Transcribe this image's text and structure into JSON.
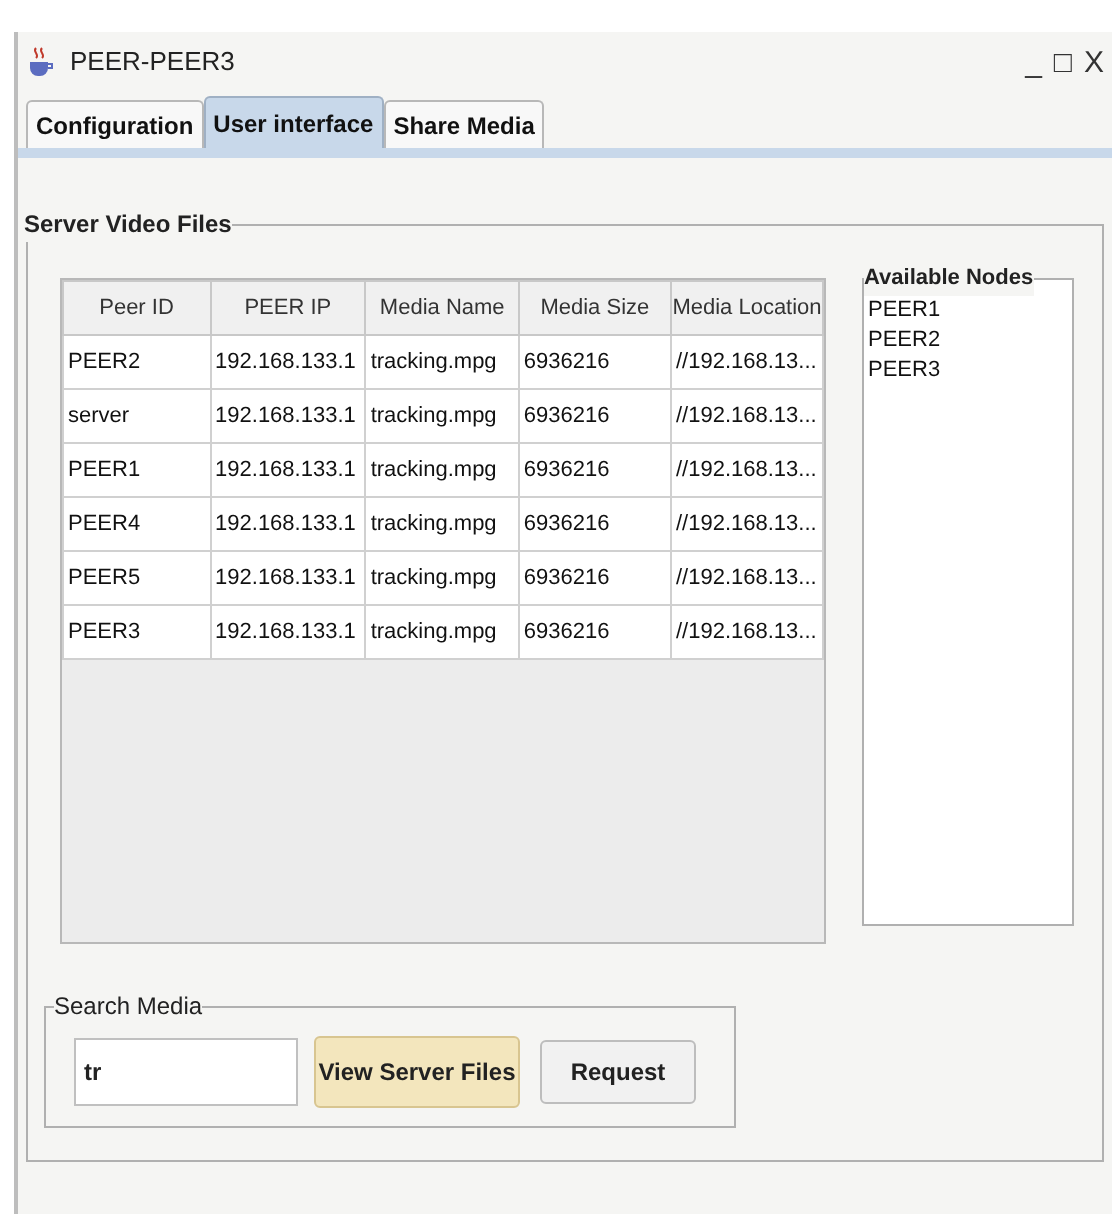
{
  "window": {
    "title": "PEER-PEER3",
    "controls": [
      "_",
      "□",
      "X"
    ]
  },
  "tabs": [
    {
      "label": "Configuration",
      "selected": false
    },
    {
      "label": "User interface",
      "selected": true
    },
    {
      "label": "Share Media",
      "selected": false
    }
  ],
  "server_video_files": {
    "title": "Server Video Files",
    "table": {
      "columns": [
        "Peer ID",
        "PEER IP",
        "Media Name",
        "Media Size",
        "Media Location"
      ],
      "rows": [
        [
          "PEER2",
          "192.168.133.1",
          "tracking.mpg",
          "6936216",
          "//192.168.13..."
        ],
        [
          "server",
          "192.168.133.1",
          "tracking.mpg",
          "6936216",
          "//192.168.13..."
        ],
        [
          "PEER1",
          "192.168.133.1",
          "tracking.mpg",
          "6936216",
          "//192.168.13..."
        ],
        [
          "PEER4",
          "192.168.133.1",
          "tracking.mpg",
          "6936216",
          "//192.168.13..."
        ],
        [
          "PEER5",
          "192.168.133.1",
          "tracking.mpg",
          "6936216",
          "//192.168.13..."
        ],
        [
          "PEER3",
          "192.168.133.1",
          "tracking.mpg",
          "6936216",
          "//192.168.13..."
        ]
      ]
    },
    "available_nodes": {
      "title": "Available Nodes",
      "items": [
        "PEER1",
        "PEER2",
        "PEER3"
      ]
    }
  },
  "search_media": {
    "title": "Search Media",
    "value": "tr",
    "buttons": [
      {
        "label": "View Server Files",
        "kind": "primary"
      },
      {
        "label": "Request",
        "kind": "secondary"
      }
    ]
  }
}
